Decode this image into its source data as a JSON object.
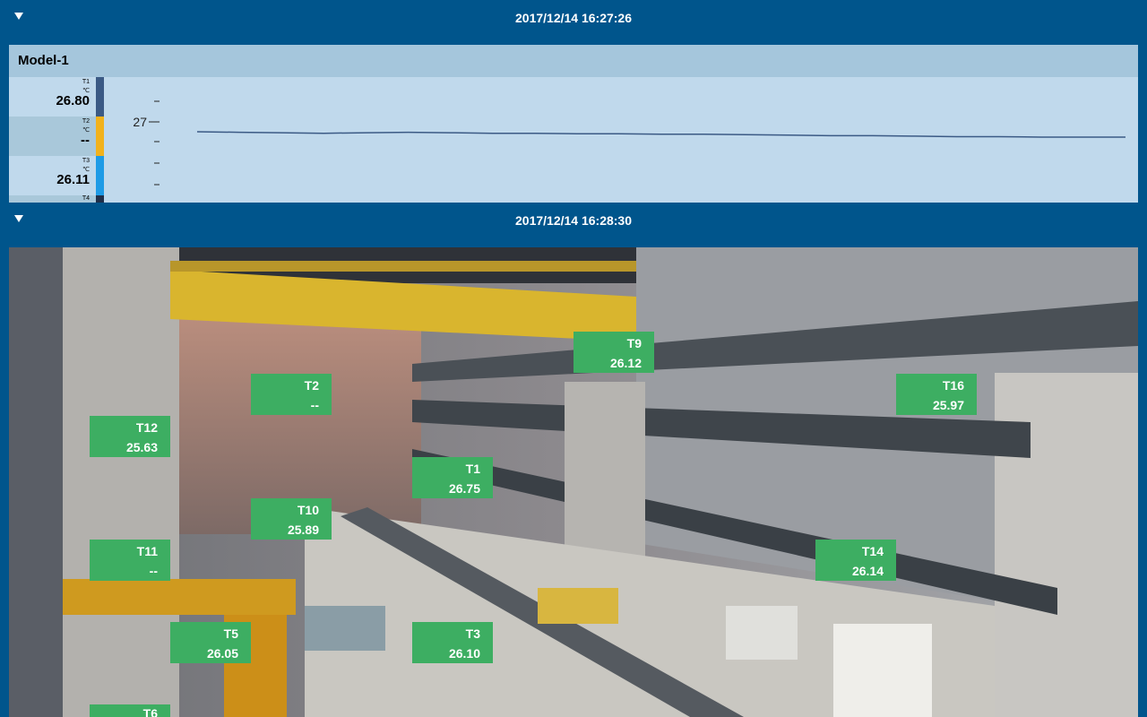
{
  "header1": {
    "timestamp": "2017/12/14 16:27:26",
    "toggle_icon": "triangle-down-icon"
  },
  "model": {
    "title": "Model-1",
    "sensors": [
      {
        "name": "T1",
        "unit": "℃",
        "value": "26.80",
        "color": "#3b5a85"
      },
      {
        "name": "T2",
        "unit": "℃",
        "value": "--",
        "color": "#f2b21c"
      },
      {
        "name": "T3",
        "unit": "℃",
        "value": "26.11",
        "color": "#1e9be6"
      },
      {
        "name": "T4",
        "unit": "",
        "value": "",
        "color": "#1f2f4a"
      }
    ],
    "axis_tick": "27"
  },
  "chart_data": {
    "type": "line",
    "ytick_labels": [
      "27"
    ],
    "series": [
      {
        "color": "#3b5a85",
        "values": [
          26.8,
          26.79,
          26.78,
          26.77,
          26.78,
          26.79,
          26.78,
          26.77,
          26.77,
          26.76,
          26.76,
          26.75,
          26.75,
          26.74,
          26.73,
          26.72,
          26.72,
          26.71,
          26.7,
          26.7,
          26.69,
          26.69,
          26.69
        ]
      }
    ]
  },
  "header2": {
    "timestamp": "2017/12/14 16:28:30",
    "toggle_icon": "triangle-down-icon"
  },
  "tags": [
    {
      "name": "T9",
      "value": "26.12"
    },
    {
      "name": "T16",
      "value": "25.97"
    },
    {
      "name": "T2",
      "value": "--"
    },
    {
      "name": "T12",
      "value": "25.63"
    },
    {
      "name": "T1",
      "value": "26.75"
    },
    {
      "name": "T10",
      "value": "25.89"
    },
    {
      "name": "T11",
      "value": "--"
    },
    {
      "name": "T14",
      "value": "26.14"
    },
    {
      "name": "T5",
      "value": "26.05"
    },
    {
      "name": "T3",
      "value": "26.10"
    },
    {
      "name": "T6",
      "value": ""
    }
  ]
}
